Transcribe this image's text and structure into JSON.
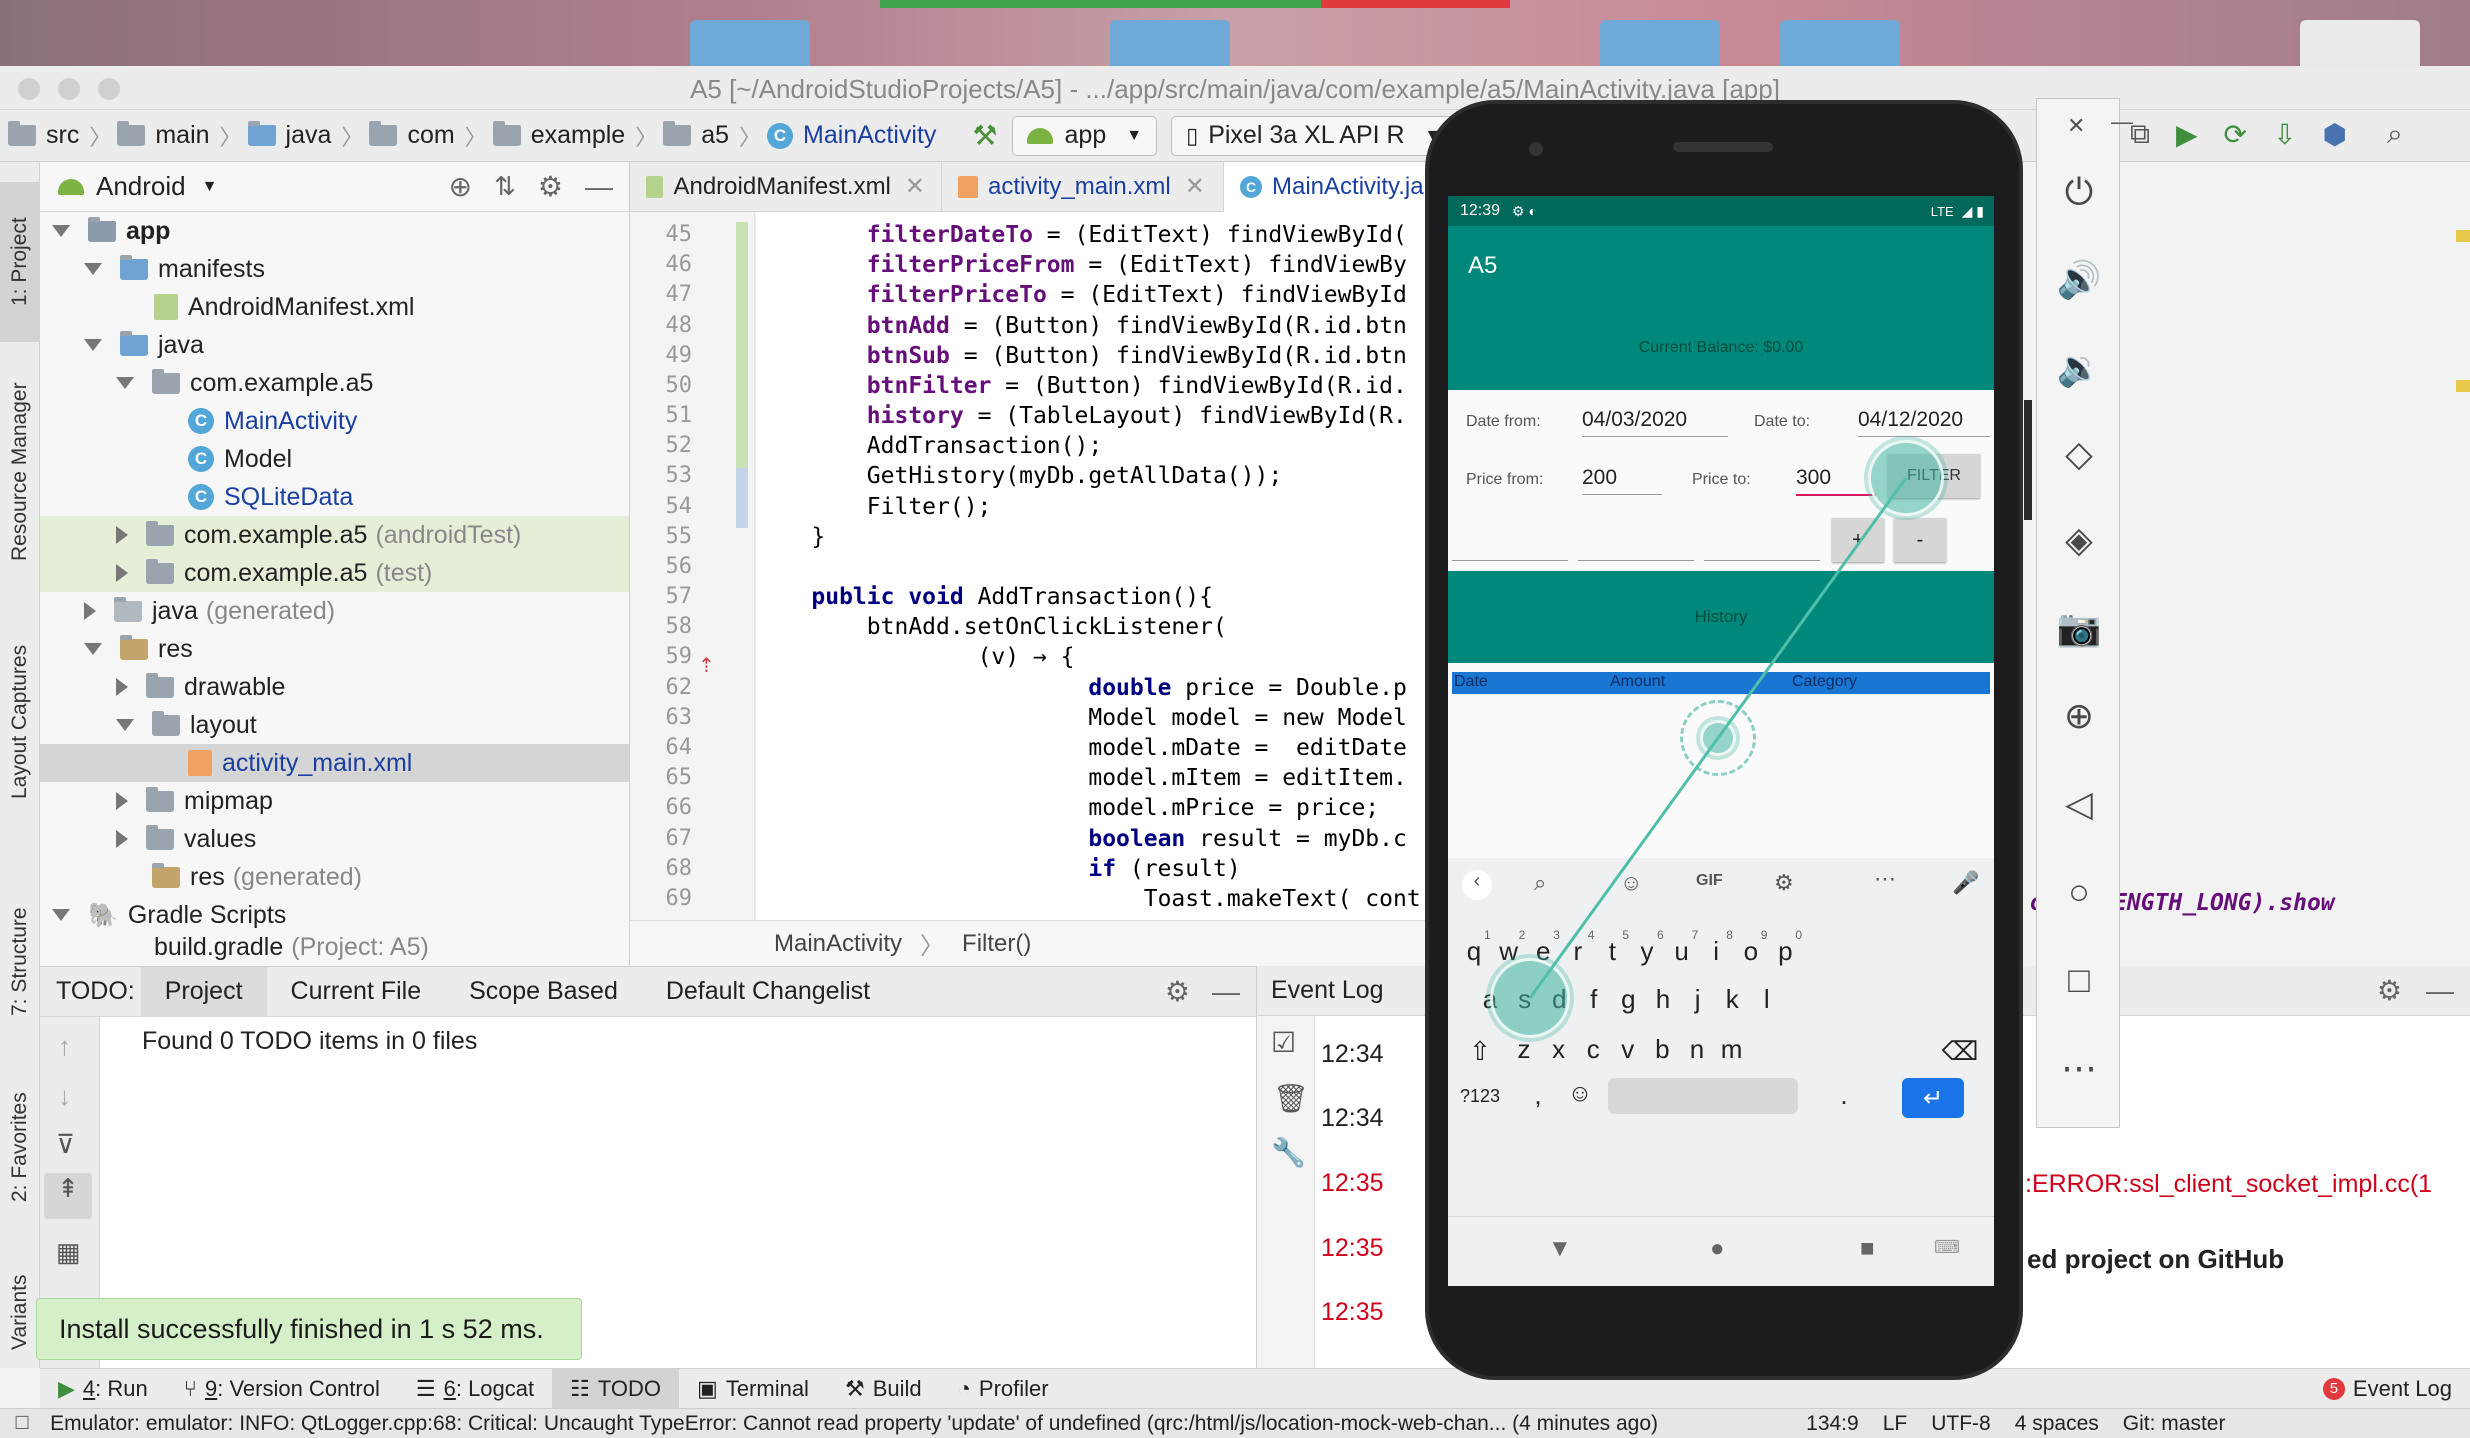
{
  "window": {
    "title": "A5 [~/AndroidStudioProjects/A5] - .../app/src/main/java/com/example/a5/MainActivity.java [app]"
  },
  "navbar": {
    "crumbs": [
      "src",
      "main",
      "java",
      "com",
      "example",
      "a5",
      "MainActivity"
    ],
    "run_config": "app",
    "device": "Pixel 3a XL API R"
  },
  "side_tools": {
    "project": "1: Project",
    "resource_manager": "Resource Manager",
    "layout_captures": "Layout Captures",
    "structure": "7: Structure",
    "favorites": "2: Favorites",
    "build_variants": "Variants"
  },
  "project": {
    "view": "Android",
    "tree": [
      {
        "label": "app",
        "suffix": ""
      },
      {
        "label": "manifests",
        "suffix": ""
      },
      {
        "label": "AndroidManifest.xml",
        "suffix": ""
      },
      {
        "label": "java",
        "suffix": ""
      },
      {
        "label": "com.example.a5",
        "suffix": ""
      },
      {
        "label": "MainActivity",
        "suffix": ""
      },
      {
        "label": "Model",
        "suffix": ""
      },
      {
        "label": "SQLiteData",
        "suffix": ""
      },
      {
        "label": "com.example.a5",
        "suffix": "(androidTest)"
      },
      {
        "label": "com.example.a5",
        "suffix": "(test)"
      },
      {
        "label": "java",
        "suffix": "(generated)"
      },
      {
        "label": "res",
        "suffix": ""
      },
      {
        "label": "drawable",
        "suffix": ""
      },
      {
        "label": "layout",
        "suffix": ""
      },
      {
        "label": "activity_main.xml",
        "suffix": ""
      },
      {
        "label": "mipmap",
        "suffix": ""
      },
      {
        "label": "values",
        "suffix": ""
      },
      {
        "label": "res",
        "suffix": "(generated)"
      },
      {
        "label": "Gradle Scripts",
        "suffix": ""
      },
      {
        "label": "build.gradle",
        "suffix": "(Project: A5)"
      }
    ]
  },
  "editor": {
    "tabs": [
      "AndroidManifest.xml",
      "activity_main.xml",
      "MainActivity.ja"
    ],
    "line_numbers": [
      "45",
      "46",
      "47",
      "48",
      "49",
      "50",
      "51",
      "52",
      "53",
      "54",
      "55",
      "56",
      "57",
      "58",
      "59",
      "62",
      "63",
      "64",
      "65",
      "66",
      "67",
      "68",
      "69"
    ],
    "lines": [
      {
        "indent": "        ",
        "a": "filterDateTo",
        "b": " = (EditText) findViewById("
      },
      {
        "indent": "        ",
        "a": "filterPriceFrom",
        "b": " = (EditText) findViewBy"
      },
      {
        "indent": "        ",
        "a": "filterPriceTo",
        "b": " = (EditText) findViewById"
      },
      {
        "indent": "        ",
        "a": "btnAdd",
        "b": " = (Button) findViewById(R.id.btn"
      },
      {
        "indent": "        ",
        "a": "btnSub",
        "b": " = (Button) findViewById(R.id.btn"
      },
      {
        "indent": "        ",
        "a": "btnFilter",
        "b": " = (Button) findViewById(R.id."
      },
      {
        "indent": "        ",
        "a": "history",
        "b": " = (TableLayout) findViewById(R."
      },
      {
        "indent": "        ",
        "a": "",
        "b": "AddTransaction();"
      },
      {
        "indent": "        ",
        "a": "",
        "b": "GetHistory(myDb.getAllData());"
      },
      {
        "indent": "        ",
        "a": "",
        "b": "Filter();"
      },
      {
        "indent": "    ",
        "a": "",
        "b": "}"
      },
      {
        "indent": "",
        "a": "",
        "b": ""
      },
      {
        "indent": "    ",
        "a": "public void",
        "b": " AddTransaction(){"
      },
      {
        "indent": "        ",
        "a": "",
        "b": "btnAdd.setOnClickListener("
      },
      {
        "indent": "                ",
        "a": "",
        "b": "(v) → {"
      },
      {
        "indent": "                        ",
        "a": "double",
        "b": " price = Double.p"
      },
      {
        "indent": "                        ",
        "a": "",
        "b": "Model model = new Model"
      },
      {
        "indent": "                        ",
        "a": "",
        "b": "model.mDate =  editDate"
      },
      {
        "indent": "                        ",
        "a": "",
        "b": "model.mItem = editItem."
      },
      {
        "indent": "                        ",
        "a": "",
        "b": "model.mPrice = price;"
      },
      {
        "indent": "                        ",
        "a": "boolean",
        "b": " result = myDb.c"
      },
      {
        "indent": "                        ",
        "a": "if",
        "b": " (result)"
      },
      {
        "indent": "                            ",
        "a": "",
        "b": "Toast.makeText( cont"
      }
    ],
    "overflow_right": "oast.LENGTH_LONG).show",
    "breadcrumb": [
      "MainActivity",
      "Filter()"
    ]
  },
  "todo": {
    "label": "TODO:",
    "tabs": [
      "Project",
      "Current File",
      "Scope Based",
      "Default Changelist"
    ],
    "message": "Found 0 TODO items in 0 files"
  },
  "event_log": {
    "title": "Event Log",
    "times": [
      "12:34",
      "12:34",
      "12:35",
      "12:35",
      "12:35"
    ],
    "error_text": ":ERROR:ssl_client_socket_impl.cc(1",
    "github_text": "ed project on GitHub"
  },
  "toast": "Install successfully finished in 1 s 52 ms.",
  "toolwindows": [
    {
      "num": "4",
      "label": ": Run"
    },
    {
      "num": "9",
      "label": ": Version Control"
    },
    {
      "num": "6",
      "label": ": Logcat"
    },
    {
      "num": "",
      "label": "TODO"
    },
    {
      "num": "",
      "label": "Terminal"
    },
    {
      "num": "",
      "label": "Build"
    },
    {
      "num": "",
      "label": "Profiler"
    }
  ],
  "event_log_btn": "Event Log",
  "event_log_count": "5",
  "status": {
    "message": "Emulator: emulator: INFO: QtLogger.cpp:68: Critical: Uncaught TypeError: Cannot read property 'update' of undefined (qrc:/html/js/location-mock-web-chan... (4 minutes ago)",
    "position": "134:9",
    "line_sep": "LF",
    "encoding": "UTF-8",
    "indent": "4 spaces",
    "vcs": "Git: master"
  },
  "phone": {
    "time": "12:39",
    "net": "LTE",
    "app_title": "A5",
    "balance": "Current Balance: $0.00",
    "date_from_label": "Date from:",
    "date_from": "04/03/2020",
    "date_to_label": "Date to:",
    "date_to": "04/12/2020",
    "price_from_label": "Price from:",
    "price_from": "200",
    "price_to_label": "Price to:",
    "price_to": "300",
    "filter_btn": "FILTER",
    "plus_btn": "+",
    "minus_btn": "-",
    "history": "History",
    "table_headers": [
      "Date",
      "Amount",
      "Category"
    ],
    "kb_row1": [
      "q",
      "w",
      "e",
      "r",
      "t",
      "y",
      "u",
      "i",
      "o",
      "p"
    ],
    "kb_row1_nums": [
      "1",
      "2",
      "3",
      "4",
      "5",
      "6",
      "7",
      "8",
      "9",
      "0"
    ],
    "kb_row2": [
      "a",
      "s",
      "d",
      "f",
      "g",
      "h",
      "j",
      "k",
      "l"
    ],
    "kb_row3": [
      "z",
      "x",
      "c",
      "v",
      "b",
      "n",
      "m"
    ],
    "kb_symbols": "?123",
    "kb_comma": ",",
    "kb_period": ".",
    "kb_gif": "GIF"
  },
  "colors": {
    "teal": "#00897b",
    "teal_dark": "#00695c",
    "table_blue": "#1976d2",
    "error_red": "#d0021b",
    "keyword_navy": "#000080",
    "field_purple": "#660e7a"
  }
}
